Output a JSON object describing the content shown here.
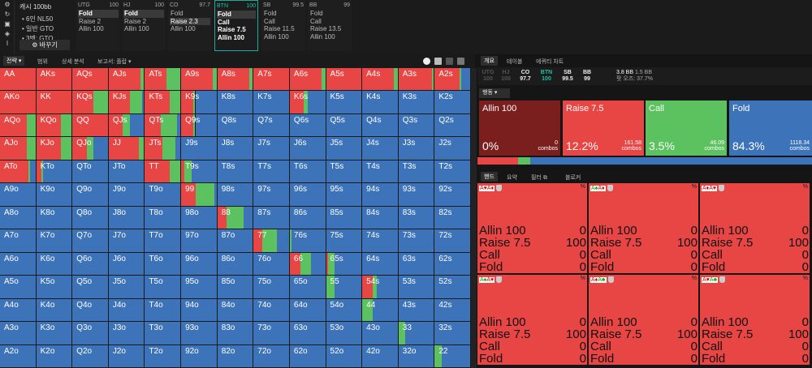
{
  "top": {
    "setup": {
      "title": "캐시 100bb",
      "lines": [
        "• 6인 NL50",
        "• 일반 GTO",
        "• 3벳: GTO"
      ],
      "change_button": "바꾸기"
    },
    "positions": [
      {
        "name": "UTG",
        "stack": "100",
        "actions": [
          "Fold",
          "Raise 2",
          "Allin 100"
        ],
        "selected": 0
      },
      {
        "name": "HJ",
        "stack": "100",
        "actions": [
          "Fold",
          "Raise 2",
          "Allin 100"
        ],
        "selected": 0
      },
      {
        "name": "CO",
        "stack": "97.7",
        "actions": [
          "Fold",
          "Raise 2.3",
          "Allin 100"
        ],
        "selected": 1
      },
      {
        "name": "BTN",
        "stack": "100",
        "actions": [
          "Fold",
          "Call",
          "Raise 7.5",
          "Allin 100"
        ],
        "selected": 0
      },
      {
        "name": "SB",
        "stack": "99.5",
        "actions": [
          "Fold",
          "Call",
          "Raise 11.5",
          "Allin 100"
        ],
        "selected": -1
      },
      {
        "name": "BB",
        "stack": "99",
        "actions": [
          "Fold",
          "Call",
          "Raise 13.5",
          "Allin 100"
        ],
        "selected": -1
      }
    ]
  },
  "toolbar": {
    "tabs": [
      "전략",
      "범위",
      "상세 분석",
      "보고서: 플랍"
    ]
  },
  "grid": {
    "ranks": [
      "A",
      "K",
      "Q",
      "J",
      "T",
      "9",
      "8",
      "7",
      "6",
      "5",
      "4",
      "3",
      "2"
    ],
    "colors": {
      "allin": "#8b1c1c",
      "raise": "#e84545",
      "call": "#5cc15f",
      "fold": "#3d73b8"
    },
    "rows": [
      [
        [
          0,
          1,
          0,
          0
        ],
        [
          0,
          1,
          0,
          0
        ],
        [
          0,
          1,
          0,
          0
        ],
        [
          0,
          0.9,
          0.1,
          0
        ],
        [
          0,
          0.6,
          0.4,
          0
        ],
        [
          0,
          0.9,
          0.1,
          0
        ],
        [
          0,
          0.9,
          0.1,
          0
        ],
        [
          0,
          1,
          0,
          0
        ],
        [
          0,
          0.9,
          0.1,
          0
        ],
        [
          0,
          1,
          0,
          0
        ],
        [
          0,
          0.9,
          0.1,
          0
        ],
        [
          0,
          0.95,
          0.05,
          0
        ],
        [
          0,
          0.7,
          0.05,
          0.25
        ]
      ],
      [
        [
          0,
          1,
          0,
          0
        ],
        [
          0,
          1,
          0,
          0
        ],
        [
          0,
          0.6,
          0.4,
          0
        ],
        [
          0,
          0.6,
          0.35,
          0.05
        ],
        [
          0,
          0.7,
          0.3,
          0
        ],
        [
          0,
          0.35,
          0.05,
          0.6
        ],
        [
          0,
          0,
          0,
          1
        ],
        [
          0,
          0,
          0,
          1
        ],
        [
          0,
          0.4,
          0.1,
          0.5
        ],
        [
          0,
          0,
          0,
          1
        ],
        [
          0,
          0,
          0,
          1
        ],
        [
          0,
          0,
          0,
          1
        ],
        [
          0,
          0,
          0,
          1
        ]
      ],
      [
        [
          0,
          0.75,
          0.25,
          0
        ],
        [
          0,
          0.7,
          0.3,
          0
        ],
        [
          0,
          1,
          0,
          0
        ],
        [
          0,
          0.4,
          0.2,
          0.4
        ],
        [
          0,
          0.45,
          0.45,
          0.1
        ],
        [
          0,
          0.35,
          0.05,
          0.6
        ],
        [
          0,
          0,
          0,
          1
        ],
        [
          0,
          0,
          0,
          1
        ],
        [
          0,
          0,
          0,
          1
        ],
        [
          0,
          0,
          0,
          1
        ],
        [
          0,
          0,
          0,
          1
        ],
        [
          0,
          0,
          0,
          1
        ],
        [
          0,
          0,
          0,
          1
        ]
      ],
      [
        [
          0,
          0.75,
          0.25,
          0
        ],
        [
          0,
          0.7,
          0.3,
          0
        ],
        [
          0,
          0.4,
          0.2,
          0.4
        ],
        [
          0,
          0.85,
          0.15,
          0
        ],
        [
          0,
          0.5,
          0.35,
          0.15
        ],
        [
          0,
          0,
          0,
          1
        ],
        [
          0,
          0,
          0,
          1
        ],
        [
          0,
          0,
          0,
          1
        ],
        [
          0,
          0,
          0,
          1
        ],
        [
          0,
          0,
          0,
          1
        ],
        [
          0,
          0,
          0,
          1
        ],
        [
          0,
          0,
          0,
          1
        ],
        [
          0,
          0,
          0,
          1
        ]
      ],
      [
        [
          0,
          0.8,
          0.05,
          0.15
        ],
        [
          0,
          0.15,
          0.05,
          0.8
        ],
        [
          0,
          0,
          0,
          1
        ],
        [
          0,
          0,
          0,
          1
        ],
        [
          0,
          0.7,
          0.3,
          0
        ],
        [
          0,
          0.1,
          0.2,
          0.7
        ],
        [
          0,
          0,
          0,
          1
        ],
        [
          0,
          0,
          0,
          1
        ],
        [
          0,
          0,
          0,
          1
        ],
        [
          0,
          0,
          0,
          1
        ],
        [
          0,
          0,
          0,
          1
        ],
        [
          0,
          0,
          0,
          1
        ],
        [
          0,
          0,
          0,
          1
        ]
      ],
      [
        [
          0,
          0,
          0,
          1
        ],
        [
          0,
          0,
          0,
          1
        ],
        [
          0,
          0,
          0,
          1
        ],
        [
          0,
          0,
          0,
          1
        ],
        [
          0,
          0,
          0,
          1
        ],
        [
          0,
          0.4,
          0.55,
          0.05
        ],
        [
          0,
          0,
          0,
          1
        ],
        [
          0,
          0,
          0,
          1
        ],
        [
          0,
          0,
          0,
          1
        ],
        [
          0,
          0,
          0,
          1
        ],
        [
          0,
          0,
          0,
          1
        ],
        [
          0,
          0,
          0,
          1
        ],
        [
          0,
          0,
          0,
          1
        ]
      ],
      [
        [
          0,
          0,
          0,
          1
        ],
        [
          0,
          0,
          0,
          1
        ],
        [
          0,
          0,
          0,
          1
        ],
        [
          0,
          0,
          0,
          1
        ],
        [
          0,
          0,
          0,
          1
        ],
        [
          0,
          0,
          0,
          1
        ],
        [
          0,
          0.25,
          0.5,
          0.25
        ],
        [
          0,
          0,
          0,
          1
        ],
        [
          0,
          0,
          0,
          1
        ],
        [
          0,
          0,
          0,
          1
        ],
        [
          0,
          0,
          0,
          1
        ],
        [
          0,
          0,
          0,
          1
        ],
        [
          0,
          0,
          0,
          1
        ]
      ],
      [
        [
          0,
          0,
          0,
          1
        ],
        [
          0,
          0,
          0,
          1
        ],
        [
          0,
          0,
          0,
          1
        ],
        [
          0,
          0,
          0,
          1
        ],
        [
          0,
          0,
          0,
          1
        ],
        [
          0,
          0,
          0,
          1
        ],
        [
          0,
          0,
          0,
          1
        ],
        [
          0,
          0.25,
          0.4,
          0.35
        ],
        [
          0,
          0,
          0.05,
          0.95
        ],
        [
          0,
          0,
          0,
          1
        ],
        [
          0,
          0,
          0,
          1
        ],
        [
          0,
          0,
          0,
          1
        ],
        [
          0,
          0,
          0,
          1
        ]
      ],
      [
        [
          0,
          0,
          0,
          1
        ],
        [
          0,
          0,
          0,
          1
        ],
        [
          0,
          0,
          0,
          1
        ],
        [
          0,
          0,
          0,
          1
        ],
        [
          0,
          0,
          0,
          1
        ],
        [
          0,
          0,
          0,
          1
        ],
        [
          0,
          0,
          0,
          1
        ],
        [
          0,
          0,
          0,
          1
        ],
        [
          0,
          0.3,
          0.3,
          0.4
        ],
        [
          0,
          0.05,
          0.2,
          0.75
        ],
        [
          0,
          0,
          0,
          1
        ],
        [
          0,
          0,
          0,
          1
        ],
        [
          0,
          0,
          0,
          1
        ]
      ],
      [
        [
          0,
          0,
          0,
          1
        ],
        [
          0,
          0,
          0,
          1
        ],
        [
          0,
          0,
          0,
          1
        ],
        [
          0,
          0,
          0,
          1
        ],
        [
          0,
          0,
          0,
          1
        ],
        [
          0,
          0,
          0,
          1
        ],
        [
          0,
          0,
          0,
          1
        ],
        [
          0,
          0,
          0,
          1
        ],
        [
          0,
          0,
          0,
          1
        ],
        [
          0,
          0,
          0.25,
          0.75
        ],
        [
          0,
          0.3,
          0.1,
          0.6
        ],
        [
          0,
          0,
          0,
          1
        ],
        [
          0,
          0,
          0,
          1
        ]
      ],
      [
        [
          0,
          0,
          0,
          1
        ],
        [
          0,
          0,
          0,
          1
        ],
        [
          0,
          0,
          0,
          1
        ],
        [
          0,
          0,
          0,
          1
        ],
        [
          0,
          0,
          0,
          1
        ],
        [
          0,
          0,
          0,
          1
        ],
        [
          0,
          0,
          0,
          1
        ],
        [
          0,
          0,
          0,
          1
        ],
        [
          0,
          0,
          0,
          1
        ],
        [
          0,
          0,
          0,
          1
        ],
        [
          0,
          0,
          0.3,
          0.7
        ],
        [
          0,
          0,
          0,
          1
        ],
        [
          0,
          0,
          0,
          1
        ]
      ],
      [
        [
          0,
          0,
          0,
          1
        ],
        [
          0,
          0,
          0,
          1
        ],
        [
          0,
          0,
          0,
          1
        ],
        [
          0,
          0,
          0,
          1
        ],
        [
          0,
          0,
          0,
          1
        ],
        [
          0,
          0,
          0,
          1
        ],
        [
          0,
          0,
          0,
          1
        ],
        [
          0,
          0,
          0,
          1
        ],
        [
          0,
          0,
          0,
          1
        ],
        [
          0,
          0,
          0,
          1
        ],
        [
          0,
          0,
          0,
          1
        ],
        [
          0,
          0,
          0.2,
          0.8
        ],
        [
          0,
          0,
          0,
          1
        ]
      ],
      [
        [
          0,
          0,
          0,
          1
        ],
        [
          0,
          0,
          0,
          1
        ],
        [
          0,
          0,
          0,
          1
        ],
        [
          0,
          0,
          0,
          1
        ],
        [
          0,
          0,
          0,
          1
        ],
        [
          0,
          0,
          0,
          1
        ],
        [
          0,
          0,
          0,
          1
        ],
        [
          0,
          0,
          0,
          1
        ],
        [
          0,
          0,
          0,
          1
        ],
        [
          0,
          0,
          0,
          1
        ],
        [
          0,
          0,
          0,
          1
        ],
        [
          0,
          0,
          0,
          1
        ],
        [
          0,
          0,
          0.2,
          0.8
        ]
      ]
    ]
  },
  "right": {
    "tabs": [
      "개요",
      "테이블",
      "에퀴티 차트"
    ],
    "positions": [
      {
        "name": "UTG",
        "stack": "100",
        "dim": true
      },
      {
        "name": "HJ",
        "stack": "100",
        "dim": true
      },
      {
        "name": "CO",
        "stack": "97.7",
        "dim": false
      },
      {
        "name": "BTN",
        "stack": "100",
        "dim": false,
        "green": true
      },
      {
        "name": "SB",
        "stack": "99.5",
        "dim": false
      },
      {
        "name": "BB",
        "stack": "99",
        "dim": false
      }
    ],
    "pot": {
      "line1": "3.8 BB",
      "line1b": "1.5 BB",
      "line2": "팟 오즈: 37.7%"
    },
    "action_dropdown": "행동",
    "actions": [
      {
        "name": "Allin 100",
        "percent": "0%",
        "combos": "0",
        "color": "#7a1e1e",
        "frac": 0
      },
      {
        "name": "Raise 7.5",
        "percent": "12.2%",
        "combos": "161.58",
        "color": "#e84545",
        "frac": 0.122
      },
      {
        "name": "Call",
        "percent": "3.5%",
        "combos": "46.09",
        "color": "#5cc15f",
        "frac": 0.035
      },
      {
        "name": "Fold",
        "percent": "84.3%",
        "combos": "1118.34",
        "color": "#3d73b8",
        "frac": 0.843
      }
    ],
    "combos_label": "combos",
    "bottom_tabs": [
      "핸드",
      "요약",
      "필터",
      "블로커"
    ],
    "hands": [
      {
        "c1": "A♥",
        "c2": "A♦",
        "s1": "r",
        "s2": "r",
        "pct": "%",
        "rows": [
          [
            "Allin 100",
            "0"
          ],
          [
            "Raise 7.5",
            "100"
          ],
          [
            "Call",
            "0"
          ],
          [
            "Fold",
            "0"
          ]
        ]
      },
      {
        "c1": "A♠",
        "c2": "A♦",
        "s1": "k",
        "s2": "r",
        "pct": "%",
        "rows": [
          [
            "Allin 100",
            "0"
          ],
          [
            "Raise 7.5",
            "100"
          ],
          [
            "Call",
            "0"
          ],
          [
            "Fold",
            "0"
          ]
        ]
      },
      {
        "c1": "A♦",
        "c2": "A♥",
        "s1": "r",
        "s2": "r",
        "pct": "%",
        "rows": [
          [
            "Allin 100",
            "0"
          ],
          [
            "Raise 7.5",
            "100"
          ],
          [
            "Call",
            "0"
          ],
          [
            "Fold",
            "0"
          ]
        ]
      },
      {
        "c1": "A♠",
        "c2": "A♥",
        "s1": "k",
        "s2": "r",
        "pct": "%",
        "rows": [
          [
            "Allin 100",
            "0"
          ],
          [
            "Raise 7.5",
            "100"
          ],
          [
            "Call",
            "0"
          ],
          [
            "Fold",
            "0"
          ]
        ]
      },
      {
        "c1": "A♦",
        "c2": "A♣",
        "s1": "r",
        "s2": "k",
        "pct": "%",
        "rows": [
          [
            "Allin 100",
            "0"
          ],
          [
            "Raise 7.5",
            "100"
          ],
          [
            "Call",
            "0"
          ],
          [
            "Fold",
            "0"
          ]
        ]
      },
      {
        "c1": "A♥",
        "c2": "A♣",
        "s1": "r",
        "s2": "k",
        "pct": "%",
        "rows": [
          [
            "Allin 100",
            "0"
          ],
          [
            "Raise 7.5",
            "100"
          ],
          [
            "Call",
            "0"
          ],
          [
            "Fold",
            "0"
          ]
        ]
      }
    ]
  }
}
